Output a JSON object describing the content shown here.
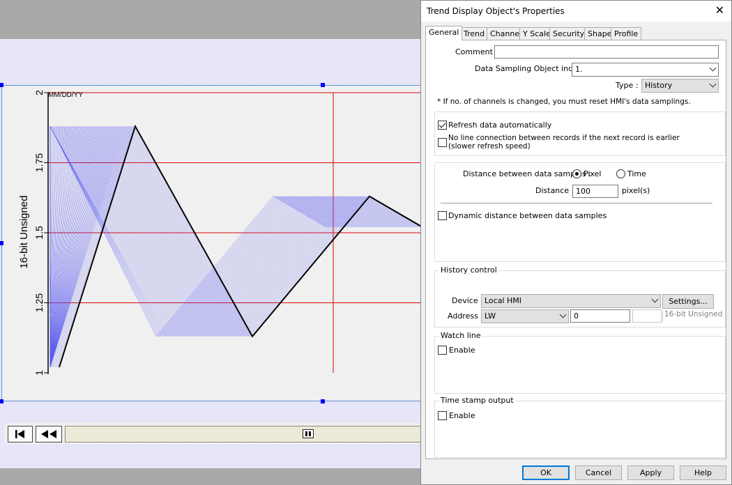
{
  "chart": {
    "date_label": "MM/DD/YY",
    "y_axis_label": "16-bit Unsigned",
    "y_ticks": [
      "2",
      "1.75",
      "1.5",
      "1.25",
      "1"
    ],
    "line_color": "#000000",
    "history_color": "#5a5af0",
    "grid_color": "#e00000"
  },
  "chart_data": {
    "type": "line",
    "ylabel": "16-bit Unsigned",
    "ylim": [
      1,
      2
    ],
    "grid": true,
    "series": [
      {
        "values": [
          1.02,
          1.88,
          1.13,
          1.63,
          1.52
        ]
      }
    ]
  },
  "dialog": {
    "title": "Trend Display Object's Properties",
    "tabs": [
      "General",
      "Trend",
      "Channel",
      "Y Scale",
      "Security",
      "Shape",
      "Profile"
    ],
    "active_tab": "General",
    "comment_label": "Comment :",
    "comment_value": "",
    "sampling_label": "Data Sampling Object index :",
    "sampling_value": "1.",
    "type_label": "Type :",
    "type_value": "History",
    "channels_note": "* If no. of channels is changed, you must reset HMI's data samplings.",
    "refresh_label": "Refresh data automatically",
    "refresh_checked": true,
    "noline_label": "No line connection between records if the next record is earlier (slower refresh speed)",
    "noline_checked": false,
    "distance_between_label": "Distance between data samples :",
    "pixel_label": "Pixel",
    "time_label": "Time",
    "distance_label": "Distance :",
    "distance_value": "100",
    "distance_unit": "pixel(s)",
    "dynamic_label": "Dynamic distance between data samples",
    "history_title": "History control",
    "device_label": "Device :",
    "device_value": "Local HMI",
    "settings_label": "Settings...",
    "address_label": "Address :",
    "address_type": "LW",
    "address_value": "0",
    "address_format": "16-bit Unsigned",
    "watch_title": "Watch line",
    "watch_enable": "Enable",
    "timestamp_title": "Time stamp output",
    "timestamp_enable": "Enable",
    "ok_label": "OK",
    "cancel_label": "Cancel",
    "apply_label": "Apply",
    "help_label": "Help"
  }
}
